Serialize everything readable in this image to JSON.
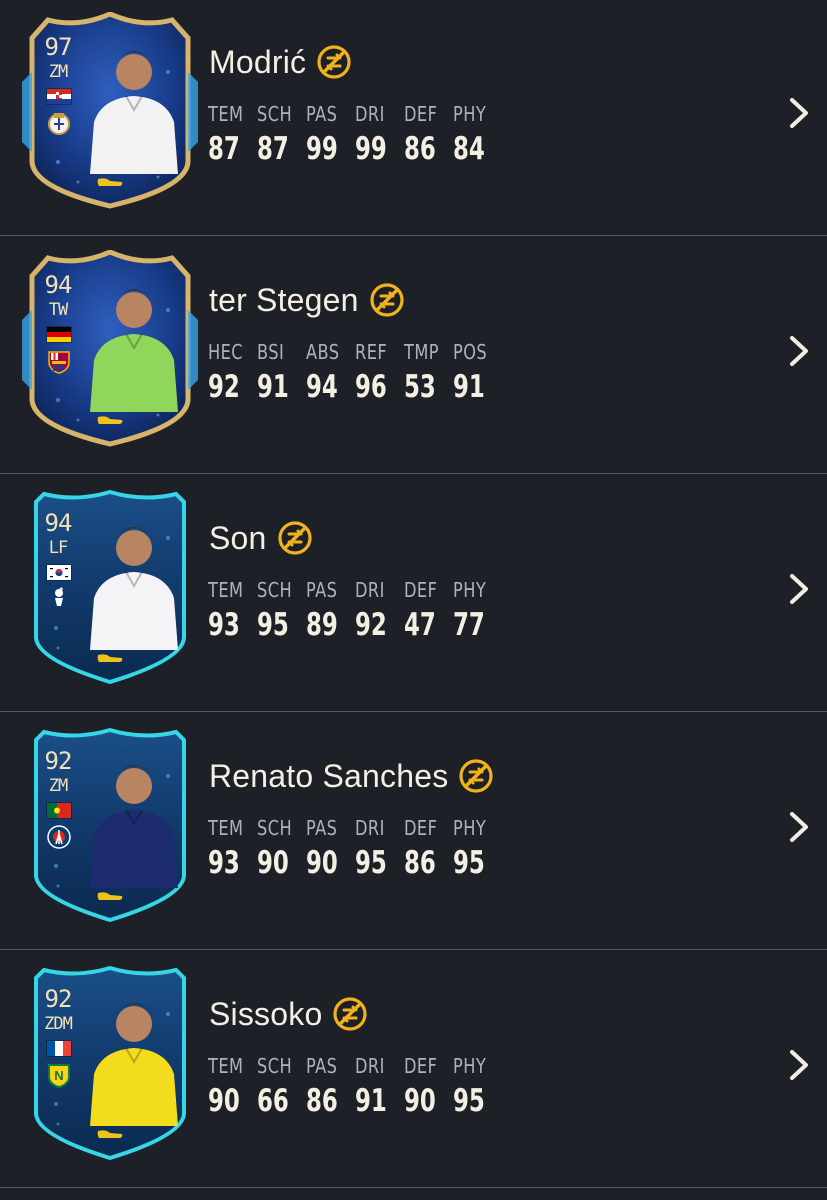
{
  "players": [
    {
      "name": "Modrić",
      "rating": "97",
      "position": "ZM",
      "card_style": "gold",
      "flag": "croatia",
      "club_icon": "real-madrid-crest-icon",
      "photo_shirt_color": "#f2f2f2",
      "stats": [
        {
          "label": "TEM",
          "value": "87"
        },
        {
          "label": "SCH",
          "value": "87"
        },
        {
          "label": "PAS",
          "value": "99"
        },
        {
          "label": "DRI",
          "value": "99"
        },
        {
          "label": "DEF",
          "value": "86"
        },
        {
          "label": "PHY",
          "value": "84"
        }
      ]
    },
    {
      "name": "ter Stegen",
      "rating": "94",
      "position": "TW",
      "card_style": "gold",
      "flag": "germany",
      "club_icon": "fc-barcelona-crest-icon",
      "photo_shirt_color": "#8fd65a",
      "stats": [
        {
          "label": "HEC",
          "value": "92"
        },
        {
          "label": "BSI",
          "value": "91"
        },
        {
          "label": "ABS",
          "value": "94"
        },
        {
          "label": "REF",
          "value": "96"
        },
        {
          "label": "TMP",
          "value": "53"
        },
        {
          "label": "POS",
          "value": "91"
        }
      ]
    },
    {
      "name": "Son",
      "rating": "94",
      "position": "LF",
      "card_style": "cyan",
      "flag": "south-korea",
      "club_icon": "tottenham-crest-icon",
      "photo_shirt_color": "#f4f4f6",
      "stats": [
        {
          "label": "TEM",
          "value": "93"
        },
        {
          "label": "SCH",
          "value": "95"
        },
        {
          "label": "PAS",
          "value": "89"
        },
        {
          "label": "DRI",
          "value": "92"
        },
        {
          "label": "DEF",
          "value": "47"
        },
        {
          "label": "PHY",
          "value": "77"
        }
      ]
    },
    {
      "name": "Renato Sanches",
      "rating": "92",
      "position": "ZM",
      "card_style": "cyan",
      "flag": "portugal",
      "club_icon": "psg-crest-icon",
      "photo_shirt_color": "#1c2c6e",
      "stats": [
        {
          "label": "TEM",
          "value": "93"
        },
        {
          "label": "SCH",
          "value": "90"
        },
        {
          "label": "PAS",
          "value": "90"
        },
        {
          "label": "DRI",
          "value": "95"
        },
        {
          "label": "DEF",
          "value": "86"
        },
        {
          "label": "PHY",
          "value": "95"
        }
      ]
    },
    {
      "name": "Sissoko",
      "rating": "92",
      "position": "ZDM",
      "card_style": "cyan",
      "flag": "france",
      "club_icon": "fc-nantes-crest-icon",
      "photo_shirt_color": "#f3dc1d",
      "stats": [
        {
          "label": "TEM",
          "value": "90"
        },
        {
          "label": "SCH",
          "value": "66"
        },
        {
          "label": "PAS",
          "value": "86"
        },
        {
          "label": "DRI",
          "value": "91"
        },
        {
          "label": "DEF",
          "value": "90"
        },
        {
          "label": "PHY",
          "value": "95"
        }
      ]
    }
  ],
  "colors": {
    "background": "#1d2127",
    "divider": "#4c5a73",
    "trait_icon": "#f2b21c",
    "stat_label": "#aeb3bb",
    "text": "#f4efe3"
  },
  "icons": {
    "trait": "untradeable-badge-icon",
    "row_action": "chevron-right-icon",
    "boot": "golden-boot-icon"
  }
}
